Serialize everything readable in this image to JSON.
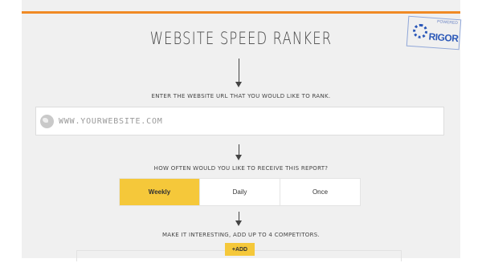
{
  "page": {
    "title": "WEBSITE SPEED RANKER"
  },
  "badge": {
    "powered_by": "POWERED",
    "brand": "RIGOR"
  },
  "step1": {
    "prompt": "ENTER THE WEBSITE URL THAT YOU WOULD LIKE TO RANK.",
    "url_placeholder": "WWW.YOURWEBSITE.COM",
    "url_value": ""
  },
  "step2": {
    "prompt": "HOW OFTEN WOULD YOU LIKE TO RECEIVE THIS REPORT?",
    "options": [
      "Weekly",
      "Daily",
      "Once"
    ],
    "selected": "Weekly"
  },
  "step3": {
    "prompt": "MAKE IT INTERESTING, ADD UP TO 4 COMPETITORS.",
    "add_label": "+ADD"
  },
  "colors": {
    "accent_bar": "#f08a24",
    "selected": "#f5c83a",
    "badge": "#2b58b8"
  },
  "icons": {
    "url_field": "globe-icon",
    "steps": "arrow-down-icon"
  }
}
